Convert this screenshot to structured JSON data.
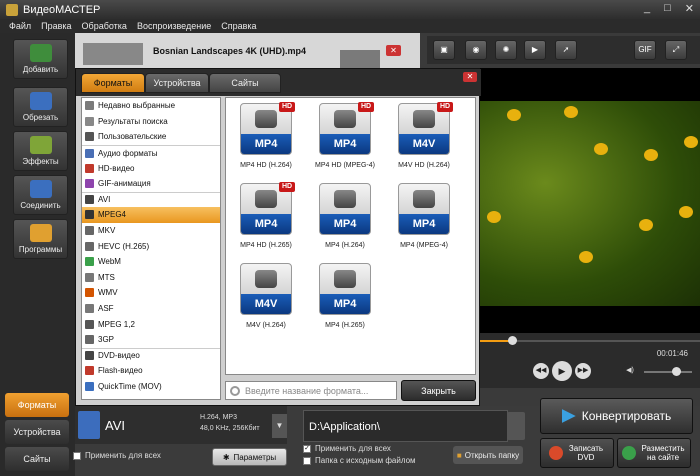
{
  "window": {
    "title": "ВидеоМАСТЕР"
  },
  "menu": [
    "Файл",
    "Правка",
    "Обработка",
    "Воспроизведение",
    "Справка"
  ],
  "sidebar": {
    "items": [
      {
        "label": "Добавить",
        "icon": "film-add-icon"
      },
      {
        "label": "Обрезать",
        "icon": "film-cut-icon"
      },
      {
        "label": "Эффекты",
        "icon": "effects-icon"
      },
      {
        "label": "Соединить",
        "icon": "join-icon"
      },
      {
        "label": "Программы",
        "icon": "programs-icon"
      }
    ],
    "tabs": [
      "Форматы",
      "Устройства",
      "Сайты"
    ]
  },
  "file": {
    "name": "Bosnian Landscapes 4K (UHD).mp4"
  },
  "preview": {
    "time": "00:01:46",
    "progress": 0.15
  },
  "dialog": {
    "tabs": [
      "Форматы",
      "Устройства",
      "Сайты"
    ],
    "categories": [
      "Недавно выбранные",
      "Результаты поиска",
      "Пользовательские",
      "Аудио форматы",
      "HD-видео",
      "GIF-анимация",
      "AVI",
      "MPEG4",
      "MKV",
      "HEVC (H.265)",
      "WebM",
      "MTS",
      "WMV",
      "ASF",
      "MPEG 1,2",
      "3GP",
      "DVD-видео",
      "Flash-видео",
      "QuickTime (MOV)"
    ],
    "selected_category": "MPEG4",
    "formats": [
      {
        "label": "MP4",
        "hd": true,
        "caption": "MP4 HD (H.264)"
      },
      {
        "label": "MP4",
        "hd": true,
        "caption": "MP4 HD (MPEG-4)"
      },
      {
        "label": "M4V",
        "hd": true,
        "caption": "M4V HD (H.264)"
      },
      {
        "label": "MP4",
        "hd": true,
        "caption": "MP4 HD (H.265)"
      },
      {
        "label": "MP4",
        "hd": false,
        "caption": "MP4 (H.264)"
      },
      {
        "label": "MP4",
        "hd": false,
        "caption": "MP4 (MPEG-4)"
      },
      {
        "label": "M4V",
        "hd": false,
        "caption": "M4V (H.264)"
      },
      {
        "label": "MP4",
        "hd": false,
        "caption": "MP4 (H.265)"
      }
    ],
    "hd_badge": "HD",
    "search_placeholder": "Введите название формата...",
    "close_label": "Закрыть"
  },
  "output": {
    "format": "AVI",
    "codec_line1": "H.264, MP3",
    "codec_line2": "48,0 KHz, 256Кбит",
    "apply_all": "Применить для всех",
    "params": "Параметры",
    "path": "D:\\Application\\",
    "apply_all2": "Применить для всех",
    "source_folder": "Папка с исходным файлом",
    "open_folder": "Открыть папку"
  },
  "actions": {
    "convert": "Конвертировать",
    "dvd": "Записать DVD",
    "publish": "Разместить на сайте"
  }
}
